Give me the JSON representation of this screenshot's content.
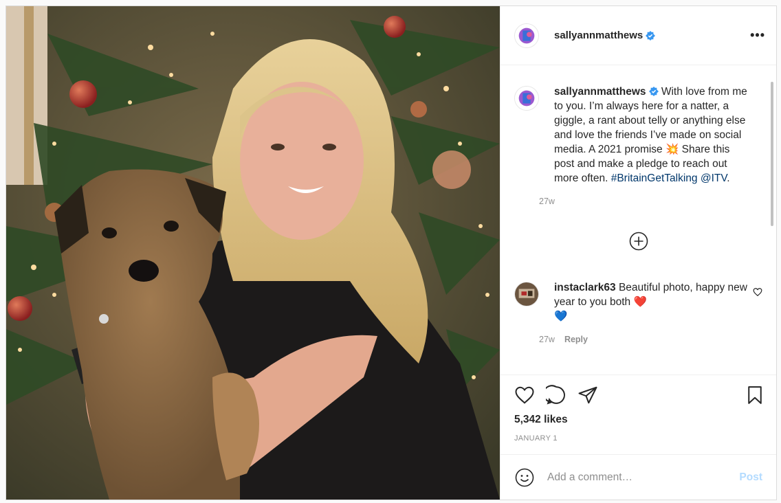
{
  "header": {
    "username": "sallyannmatthews",
    "more_label": "•••"
  },
  "caption": {
    "username": "sallyannmatthews",
    "text_before": "With love from me to you. I’m always here for a natter, a giggle, a rant about telly or anything else and love the friends I’ve made on social media. A 2021 promise ",
    "emoji": "💥",
    "text_after": " Share this post and make a pledge to reach out more often. ",
    "hashtag": "#BritainGetTalking",
    "mention": "@ITV",
    "trailing": ".",
    "time": "27w"
  },
  "comment": {
    "username": "instaclark63",
    "text": "Beautiful photo, happy new year to you both ",
    "emoji_1": "❤️",
    "emoji_2": "💙",
    "time": "27w",
    "reply_label": "Reply"
  },
  "likes": "5,342 likes",
  "date": "JANUARY 1",
  "add_comment": {
    "placeholder": "Add a comment…",
    "post_label": "Post"
  },
  "colors": {
    "verified": "#3897f0",
    "link": "#00376b",
    "post_disabled": "#b3dbff",
    "heart_red": "#ed4956"
  }
}
